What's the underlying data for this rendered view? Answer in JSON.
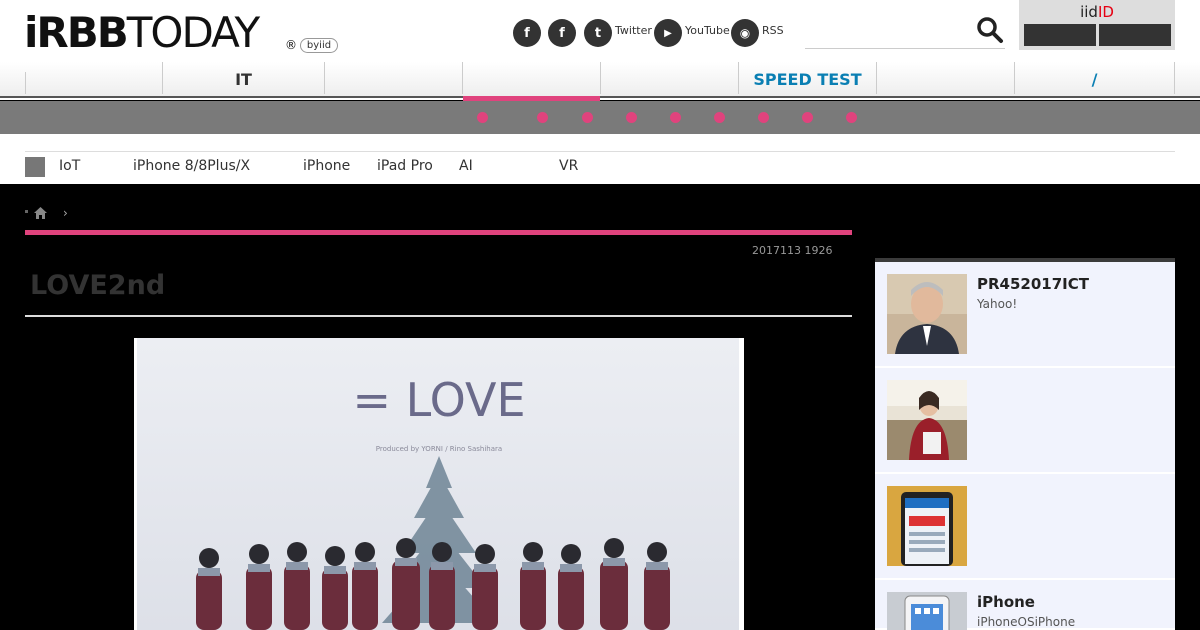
{
  "brand": {
    "logo_left": "iRBB",
    "logo_right": "TODAY",
    "registered": "®",
    "byiid": "byiid"
  },
  "header": {
    "social": [
      {
        "name": "facebook-1",
        "label": "",
        "glyph": "f"
      },
      {
        "name": "facebook-2",
        "label": "",
        "glyph": "f"
      },
      {
        "name": "twitter",
        "label": "Twitter",
        "glyph": "t"
      },
      {
        "name": "youtube",
        "label": "YouTube",
        "glyph": "▶"
      },
      {
        "name": "rss",
        "label": "RSS",
        "glyph": "◉"
      }
    ],
    "iid_prefix": "iid",
    "iid_suffix": "ID"
  },
  "nav": {
    "items": [
      "",
      "IT",
      "",
      "",
      "",
      "SPEED TEST",
      "",
      "/"
    ],
    "active_index": 3
  },
  "topics": [
    "IoT",
    "iPhone 8/8Plus/X",
    "iPhone",
    "iPad Pro",
    "AI",
    "VR"
  ],
  "breadcrumb": {
    "separator": "›"
  },
  "article": {
    "date": "2017113 1926",
    "headline": "LOVE2nd",
    "hero": {
      "logo_text": "= LOVE",
      "credit": "Produced by YORNI / Rino Sashihara"
    }
  },
  "sidebar": {
    "cards": [
      {
        "title": "PR452017ICT",
        "subtitle": "Yahoo!"
      },
      {
        "title": "",
        "subtitle": ""
      },
      {
        "title": "",
        "subtitle": ""
      },
      {
        "title": "iPhone",
        "subtitle": "iPhoneOSiPhone"
      }
    ]
  },
  "colors": {
    "accent": "#e0437d",
    "nav_blue": "#0a7fb3",
    "iid_red": "#e60012"
  }
}
